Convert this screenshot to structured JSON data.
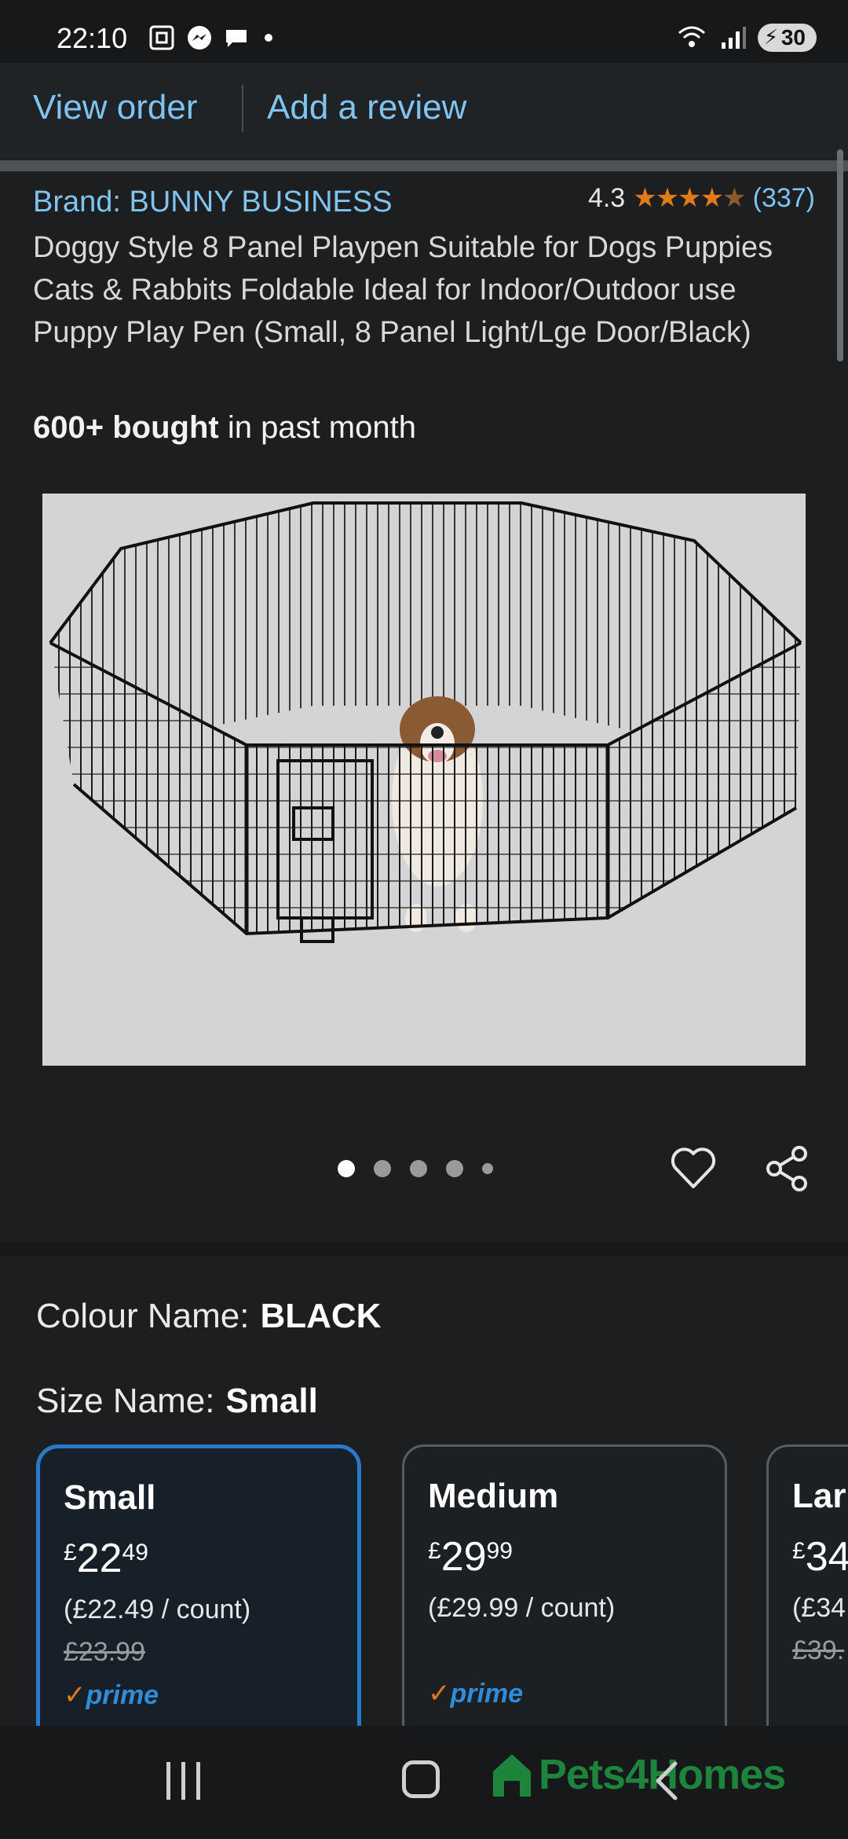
{
  "status_bar": {
    "time": "22:10",
    "battery": "30"
  },
  "order_bar": {
    "view_order": "View order",
    "add_review": "Add a review"
  },
  "product": {
    "brand": "Brand: BUNNY BUSINESS",
    "rating": "4.3",
    "stars_filled": 4.3,
    "review_count": "(337)",
    "title": "Doggy Style 8 Panel Playpen Suitable for Dogs Puppies Cats & Rabbits Foldable Ideal for Indoor/Outdoor use Puppy Play Pen (Small, 8 Panel Light/Lge Door/Black)",
    "bought_bold": "600+ bought",
    "bought_rest": " in past month"
  },
  "carousel": {
    "image_count": 5,
    "active_index": 0
  },
  "variations": {
    "colour_label": "Colour Name:",
    "colour_value": "BLACK",
    "size_label": "Size Name:",
    "size_value": "Small",
    "options": [
      {
        "name": "Small",
        "currency": "£",
        "whole": "22",
        "fraction": "49",
        "unit": "(£22.49 / count)",
        "old_price": "£23.99",
        "prime": "prime",
        "selected": true
      },
      {
        "name": "Medium",
        "currency": "£",
        "whole": "29",
        "fraction": "99",
        "unit": "(£29.99 / count)",
        "old_price": "",
        "prime": "prime",
        "selected": false
      },
      {
        "name": "Lar",
        "currency": "£",
        "whole": "34",
        "fraction": "",
        "unit": "(£34",
        "old_price": "£39.",
        "prime": "",
        "selected": false
      }
    ]
  },
  "watermark": "Pets4Homes",
  "colors": {
    "accent_link": "#7fc4f0",
    "star": "#e07a1a",
    "selected_border": "#2a79c9",
    "prime": "#2f8cd8"
  }
}
